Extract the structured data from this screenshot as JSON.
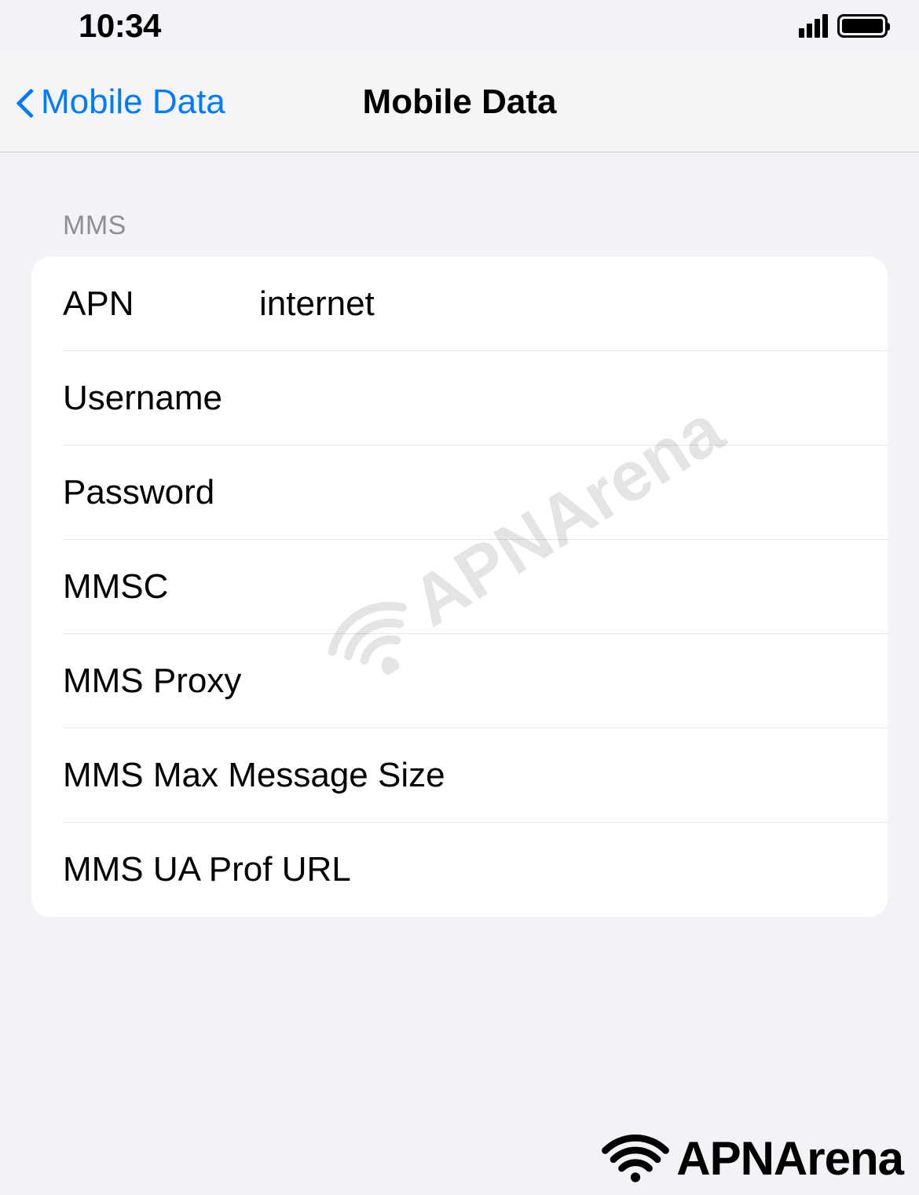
{
  "status_bar": {
    "time": "10:34"
  },
  "nav": {
    "back_label": "Mobile Data",
    "title": "Mobile Data"
  },
  "section_header": "MMS",
  "fields": {
    "apn": {
      "label": "APN",
      "value": "internet"
    },
    "username": {
      "label": "Username",
      "value": ""
    },
    "password": {
      "label": "Password",
      "value": ""
    },
    "mmsc": {
      "label": "MMSC",
      "value": ""
    },
    "mms_proxy": {
      "label": "MMS Proxy",
      "value": ""
    },
    "mms_max_size": {
      "label": "MMS Max Message Size",
      "value": ""
    },
    "mms_ua_prof_url": {
      "label": "MMS UA Prof URL",
      "value": ""
    }
  },
  "watermark": "APNArena"
}
